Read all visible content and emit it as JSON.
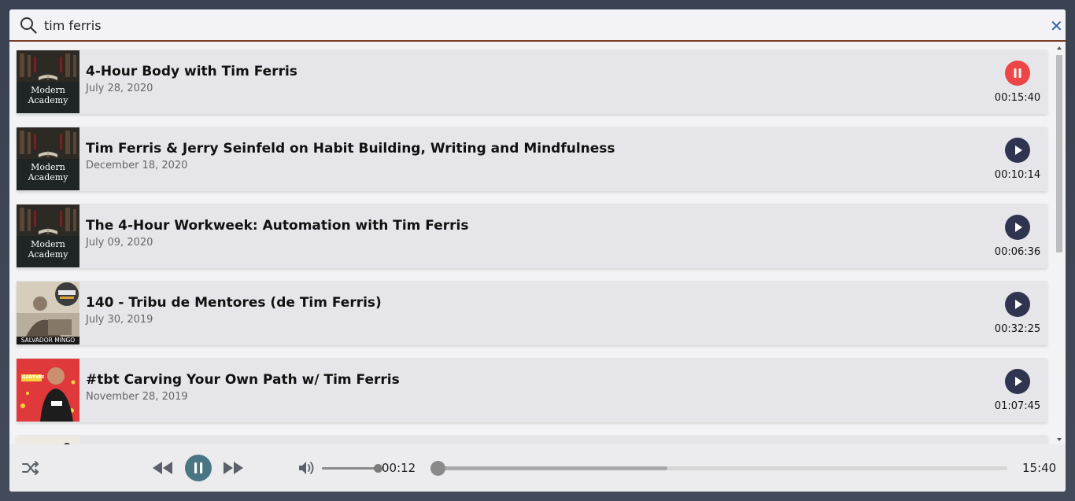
{
  "search": {
    "query": "tim ferris",
    "placeholder": ""
  },
  "episodes": [
    {
      "title": "4-Hour Body with Tim Ferris",
      "date": "July 28, 2020",
      "duration": "00:15:40",
      "state": "playing",
      "thumb_caption": "Modern Academy"
    },
    {
      "title": "Tim Ferris & Jerry Seinfeld on Habit Building, Writing and Mindfulness",
      "date": "December 18, 2020",
      "duration": "00:10:14",
      "state": "paused",
      "thumb_caption": "Modern Academy"
    },
    {
      "title": "The 4-Hour Workweek: Automation with Tim Ferris",
      "date": "July 09, 2020",
      "duration": "00:06:36",
      "state": "paused",
      "thumb_caption": "Modern Academy"
    },
    {
      "title": "140 - Tribu de Mentores (de Tim Ferris)",
      "date": "July 30, 2019",
      "duration": "00:32:25",
      "state": "paused",
      "thumb_caption": "SALVADOR MINGO"
    },
    {
      "title": "#tbt Carving Your Own Path w/ Tim Ferris",
      "date": "November 28, 2019",
      "duration": "01:07:45",
      "state": "paused",
      "thumb_caption": "GARYVEE"
    }
  ],
  "player": {
    "current_time": "00:12",
    "total_time": "15:40",
    "volume_level": 0.99,
    "progress": 0.013,
    "buffered": 0.41
  },
  "colors": {
    "accent_border": "#7a3e27",
    "play_button": "#2f3550",
    "active_button": "#ec4646",
    "player_button": "#4a7684",
    "clear_icon": "#2f5fa8"
  },
  "icons": [
    "search-icon",
    "close-icon",
    "pause-icon",
    "play-icon",
    "shuffle-icon",
    "rewind-icon",
    "fast-forward-icon",
    "volume-icon"
  ]
}
